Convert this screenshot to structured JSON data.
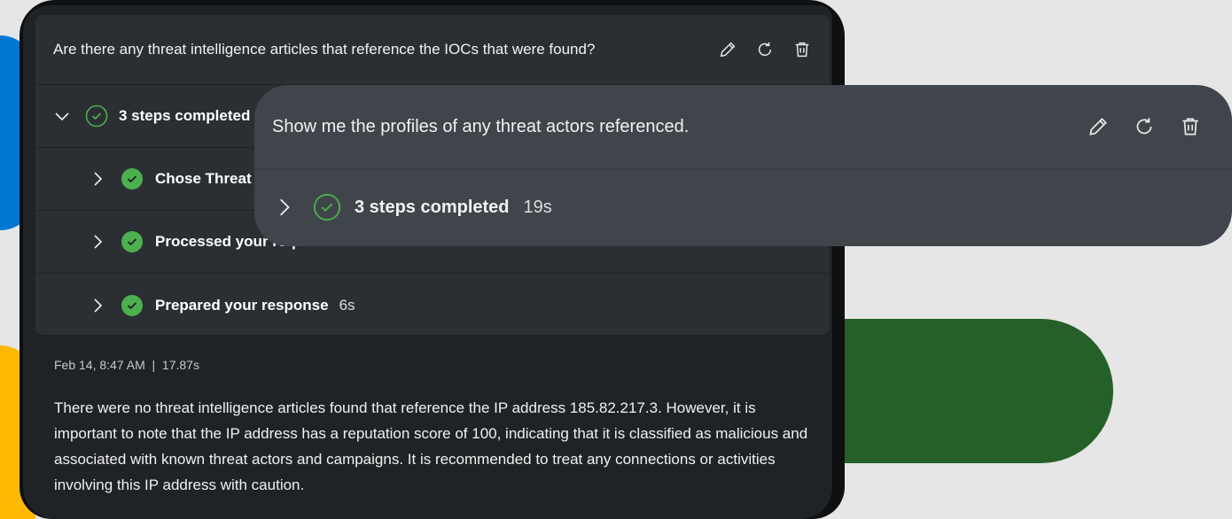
{
  "colors": {
    "accent_blue": "#0078d4",
    "accent_yellow": "#ffb900",
    "accent_green": "#256028",
    "success": "#4caf50"
  },
  "main_prompt": {
    "question": "Are there any threat intelligence articles that reference the IOCs that were found?",
    "actions": [
      "edit-icon",
      "retry-icon",
      "delete-icon"
    ],
    "summary": {
      "label": "3 steps completed",
      "status": "success",
      "expanded": true
    },
    "steps": [
      {
        "label": "Chose Threat",
        "time": ""
      },
      {
        "label": "Processed your request",
        "time": ""
      },
      {
        "label": "Prepared your response",
        "time": "6s"
      }
    ],
    "meta": "Feb 14, 8:47 AM  |  17.87s",
    "answer": "There were no threat intelligence articles found that reference the IP address 185.82.217.3. However, it is important to note that the IP address has a reputation score of 100, indicating that it is classified as malicious and associated with known threat actors and campaigns. It is recommended to treat any connections or activities involving this IP address with caution."
  },
  "overlay_prompt": {
    "question": "Show me the profiles of any threat actors referenced.",
    "actions": [
      "edit-icon",
      "retry-icon",
      "delete-icon"
    ],
    "summary": {
      "label": "3 steps completed",
      "time": "19s",
      "expanded": false
    }
  }
}
